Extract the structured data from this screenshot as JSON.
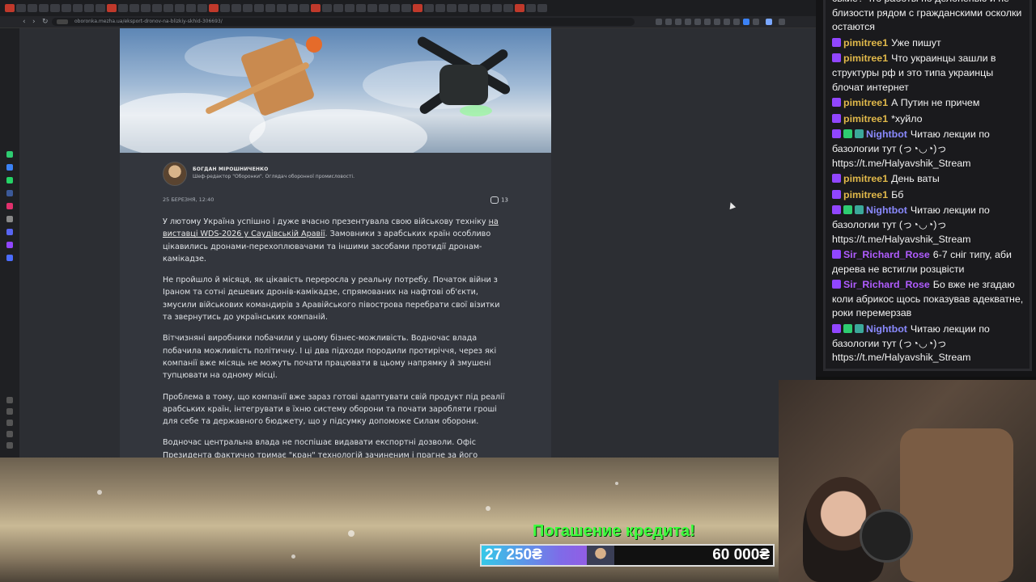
{
  "browser": {
    "url": "oboronka.mezha.ua/eksport-dronov-na-blizkiy-skhid-306693/",
    "tab_count": 48
  },
  "article": {
    "author_name": "БОГДАН МІРОШНИЧЕНКО",
    "author_role": "Шеф-редактор \"Оборонки\". Оглядач оборонної промисловості.",
    "date": "25 БЕРЕЗНЯ, 12:40",
    "comments_count": "13",
    "p1_before_link": "У лютому Україна успішно і дуже вчасно презентувала свою військову техніку ",
    "p1_link": "на виставці WDS-2026 у Саудівській Аравії",
    "p1_after_link": ". Замовники з арабських країн особливо цікавились дронами-перехоплювачами та іншими засобами протидії дронам-камікадзе.",
    "p2": "Не пройшло й місяця, як цікавість переросла у реальну потребу. Початок війни з Іраном та сотні дешевих дронів-камікадзе, спрямованих на нафтові об'єкти, змусили військових командирів з Аравійського півострова перебрати свої візитки та звернутись до українських компаній.",
    "p3": "Вітчизняні виробники побачили у цьому бізнес-можливість. Водночас влада побачила можливість політичну. І ці два підходи породили протиріччя, через які компанії вже місяць не можуть почати працювати в цьому напрямку й змушені тупцювати на одному місці.",
    "p4": "Проблема в тому, що компанії вже зараз готові адаптувати свій продукт під реалії арабських країн, інтегрувати в їхню систему оборони та почати заробляти гроші для себе та державного бюджету, що у підсумку допоможе Силам оборони.",
    "p5": "Водночас центральна влада не поспішає видавати експортні дозволи. Офіс Президента фактично тримає \"кран\" технологій зачиненим і прагне за його відкриття"
  },
  "chat": {
    "messages": [
      {
        "user": "",
        "color": "#f2f2f2",
        "badges": [],
        "text": "ськие? что работы по делоненью и не близости рядом с гражданскими осколки остаются"
      },
      {
        "user": "pimitree1",
        "color": "#e0b84a",
        "badges": [
          "sub"
        ],
        "text": "Уже пишут"
      },
      {
        "user": "pimitree1",
        "color": "#e0b84a",
        "badges": [
          "sub"
        ],
        "text": "Что украинцы зашли в структуры рф и это типа украинцы блочат интернет"
      },
      {
        "user": "pimitree1",
        "color": "#e0b84a",
        "badges": [
          "sub"
        ],
        "text": "А Путин не причем"
      },
      {
        "user": "pimitree1",
        "color": "#e0b84a",
        "badges": [
          "sub"
        ],
        "text": "*хуйло"
      },
      {
        "user": "Nightbot",
        "color": "#8a8aff",
        "badges": [
          "sub",
          "mod",
          "bot"
        ],
        "text": "Читаю лекции по базологии тут (っ◔◡◔)っ https://t.me/Halyavshik_Stream"
      },
      {
        "user": "pimitree1",
        "color": "#e0b84a",
        "badges": [
          "sub"
        ],
        "text": "День ваты"
      },
      {
        "user": "pimitree1",
        "color": "#e0b84a",
        "badges": [
          "sub"
        ],
        "text": "Бб"
      },
      {
        "user": "Nightbot",
        "color": "#8a8aff",
        "badges": [
          "sub",
          "mod",
          "bot"
        ],
        "text": "Читаю лекции по базологии тут (っ◔◡◔)っ https://t.me/Halyavshik_Stream"
      },
      {
        "user": "Sir_Richard_Rose",
        "color": "#b05cff",
        "badges": [
          "sub"
        ],
        "text": "6-7 сніг типу, аби дерева не встигли розцвісти"
      },
      {
        "user": "Sir_Richard_Rose",
        "color": "#b05cff",
        "badges": [
          "sub"
        ],
        "text": "Бо вже не згадаю коли абрикос щось показував адекватне, роки перемерзав"
      },
      {
        "user": "Nightbot",
        "color": "#8a8aff",
        "badges": [
          "sub",
          "mod",
          "bot"
        ],
        "text": "Читаю лекции по базологии тут (っ◔◡◔)っ https://t.me/Halyavshik_Stream"
      }
    ]
  },
  "overlay": {
    "credit_title": "Погашение кредита!",
    "credit_current": "27 250₴",
    "credit_goal": "60 000₴",
    "progress_fraction": 0.454
  },
  "colors": {
    "accent_green": "#3dff3d",
    "progress_start": "#35c8e8",
    "progress_end": "#a44fe0"
  }
}
